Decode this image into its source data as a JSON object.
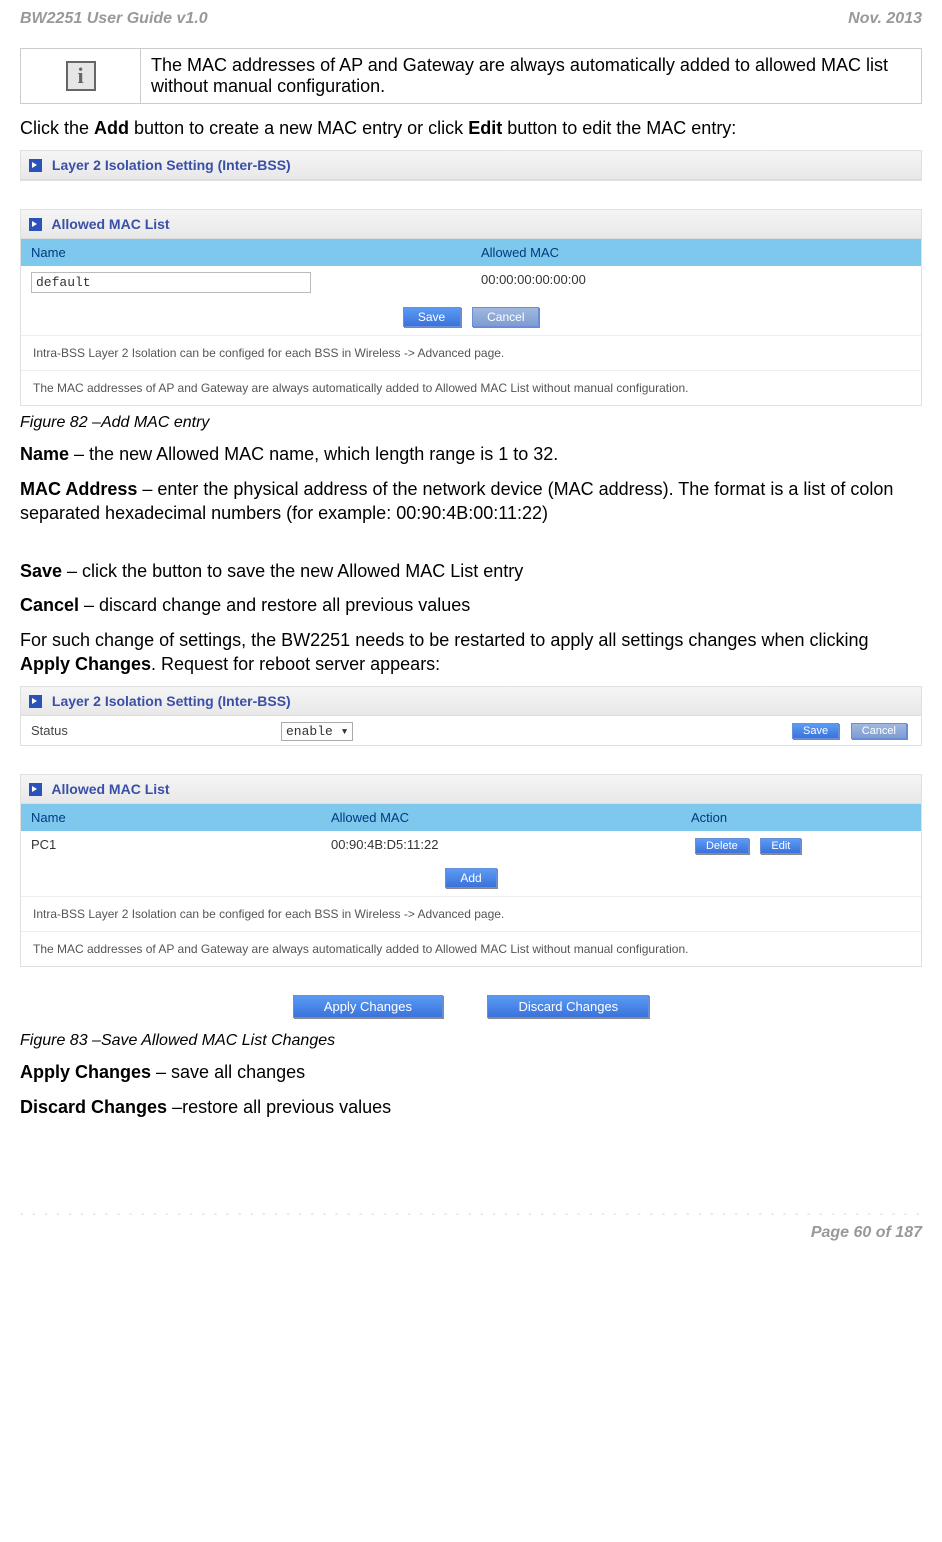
{
  "header": {
    "doc_title": "BW2251 User Guide v1.0",
    "date": "Nov.  2013"
  },
  "info_box": "The MAC addresses of AP and Gateway are always automatically added to allowed MAC list without manual configuration.",
  "intro_line_pre": "Click the ",
  "intro_add": "Add",
  "intro_mid": " button to create a new MAC entry or click ",
  "intro_edit": "Edit",
  "intro_post": " button to edit the MAC entry:",
  "panel1": {
    "title": "Layer 2 Isolation Setting (Inter-BSS)"
  },
  "panel2": {
    "title": "Allowed MAC List",
    "col_name": "Name",
    "col_mac": "Allowed MAC",
    "name_value": "default",
    "mac_value": "00:00:00:00:00:00",
    "save": "Save",
    "cancel": "Cancel",
    "note1": "Intra-BSS Layer 2 Isolation can be configed for each BSS in Wireless -> Advanced page.",
    "note2": "The MAC addresses of AP and Gateway are always automatically added to Allowed MAC List without manual configuration."
  },
  "fig82": "Figure 82 –Add MAC entry",
  "name_label": "Name",
  "name_desc": " – the new Allowed MAC name, which length range is 1 to 32.",
  "mac_label": "MAC Address",
  "mac_desc": " – enter the physical address of the network device (MAC address). The format is a list of colon separated hexadecimal numbers (for example: 00:90:4B:00:11:22)",
  "save_label": "Save",
  "save_desc": " – click the button to save the new Allowed MAC List entry",
  "cancel_label": "Cancel",
  "cancel_desc": " – discard change and restore all previous values",
  "restart_pre": "For such change of settings, the BW2251 needs to be restarted to apply all settings changes when clicking ",
  "restart_bold": "Apply Changes",
  "restart_post": ". Request for reboot server appears:",
  "panel3": {
    "title": "Layer 2 Isolation Setting (Inter-BSS)",
    "status_label": "Status",
    "status_value": "enable",
    "save": "Save",
    "cancel": "Cancel"
  },
  "panel4": {
    "title": "Allowed MAC List",
    "col_name": "Name",
    "col_mac": "Allowed MAC",
    "col_action": "Action",
    "row_name": "PC1",
    "row_mac": "00:90:4B:D5:11:22",
    "delete": "Delete",
    "edit": "Edit",
    "add": "Add",
    "note1": "Intra-BSS Layer 2 Isolation can be configed for each BSS in Wireless -> Advanced page.",
    "note2": "The MAC addresses of AP and Gateway are always automatically added to Allowed MAC List without manual configuration."
  },
  "apply_changes": "Apply Changes",
  "discard_changes": "Discard Changes",
  "fig83": "Figure 83 –Save Allowed MAC List Changes",
  "apply_label": "Apply Changes",
  "apply_desc": " – save all changes",
  "discard_label": "Discard Changes",
  "discard_desc": " –restore all previous values",
  "page_num": "Page 60 of 187"
}
